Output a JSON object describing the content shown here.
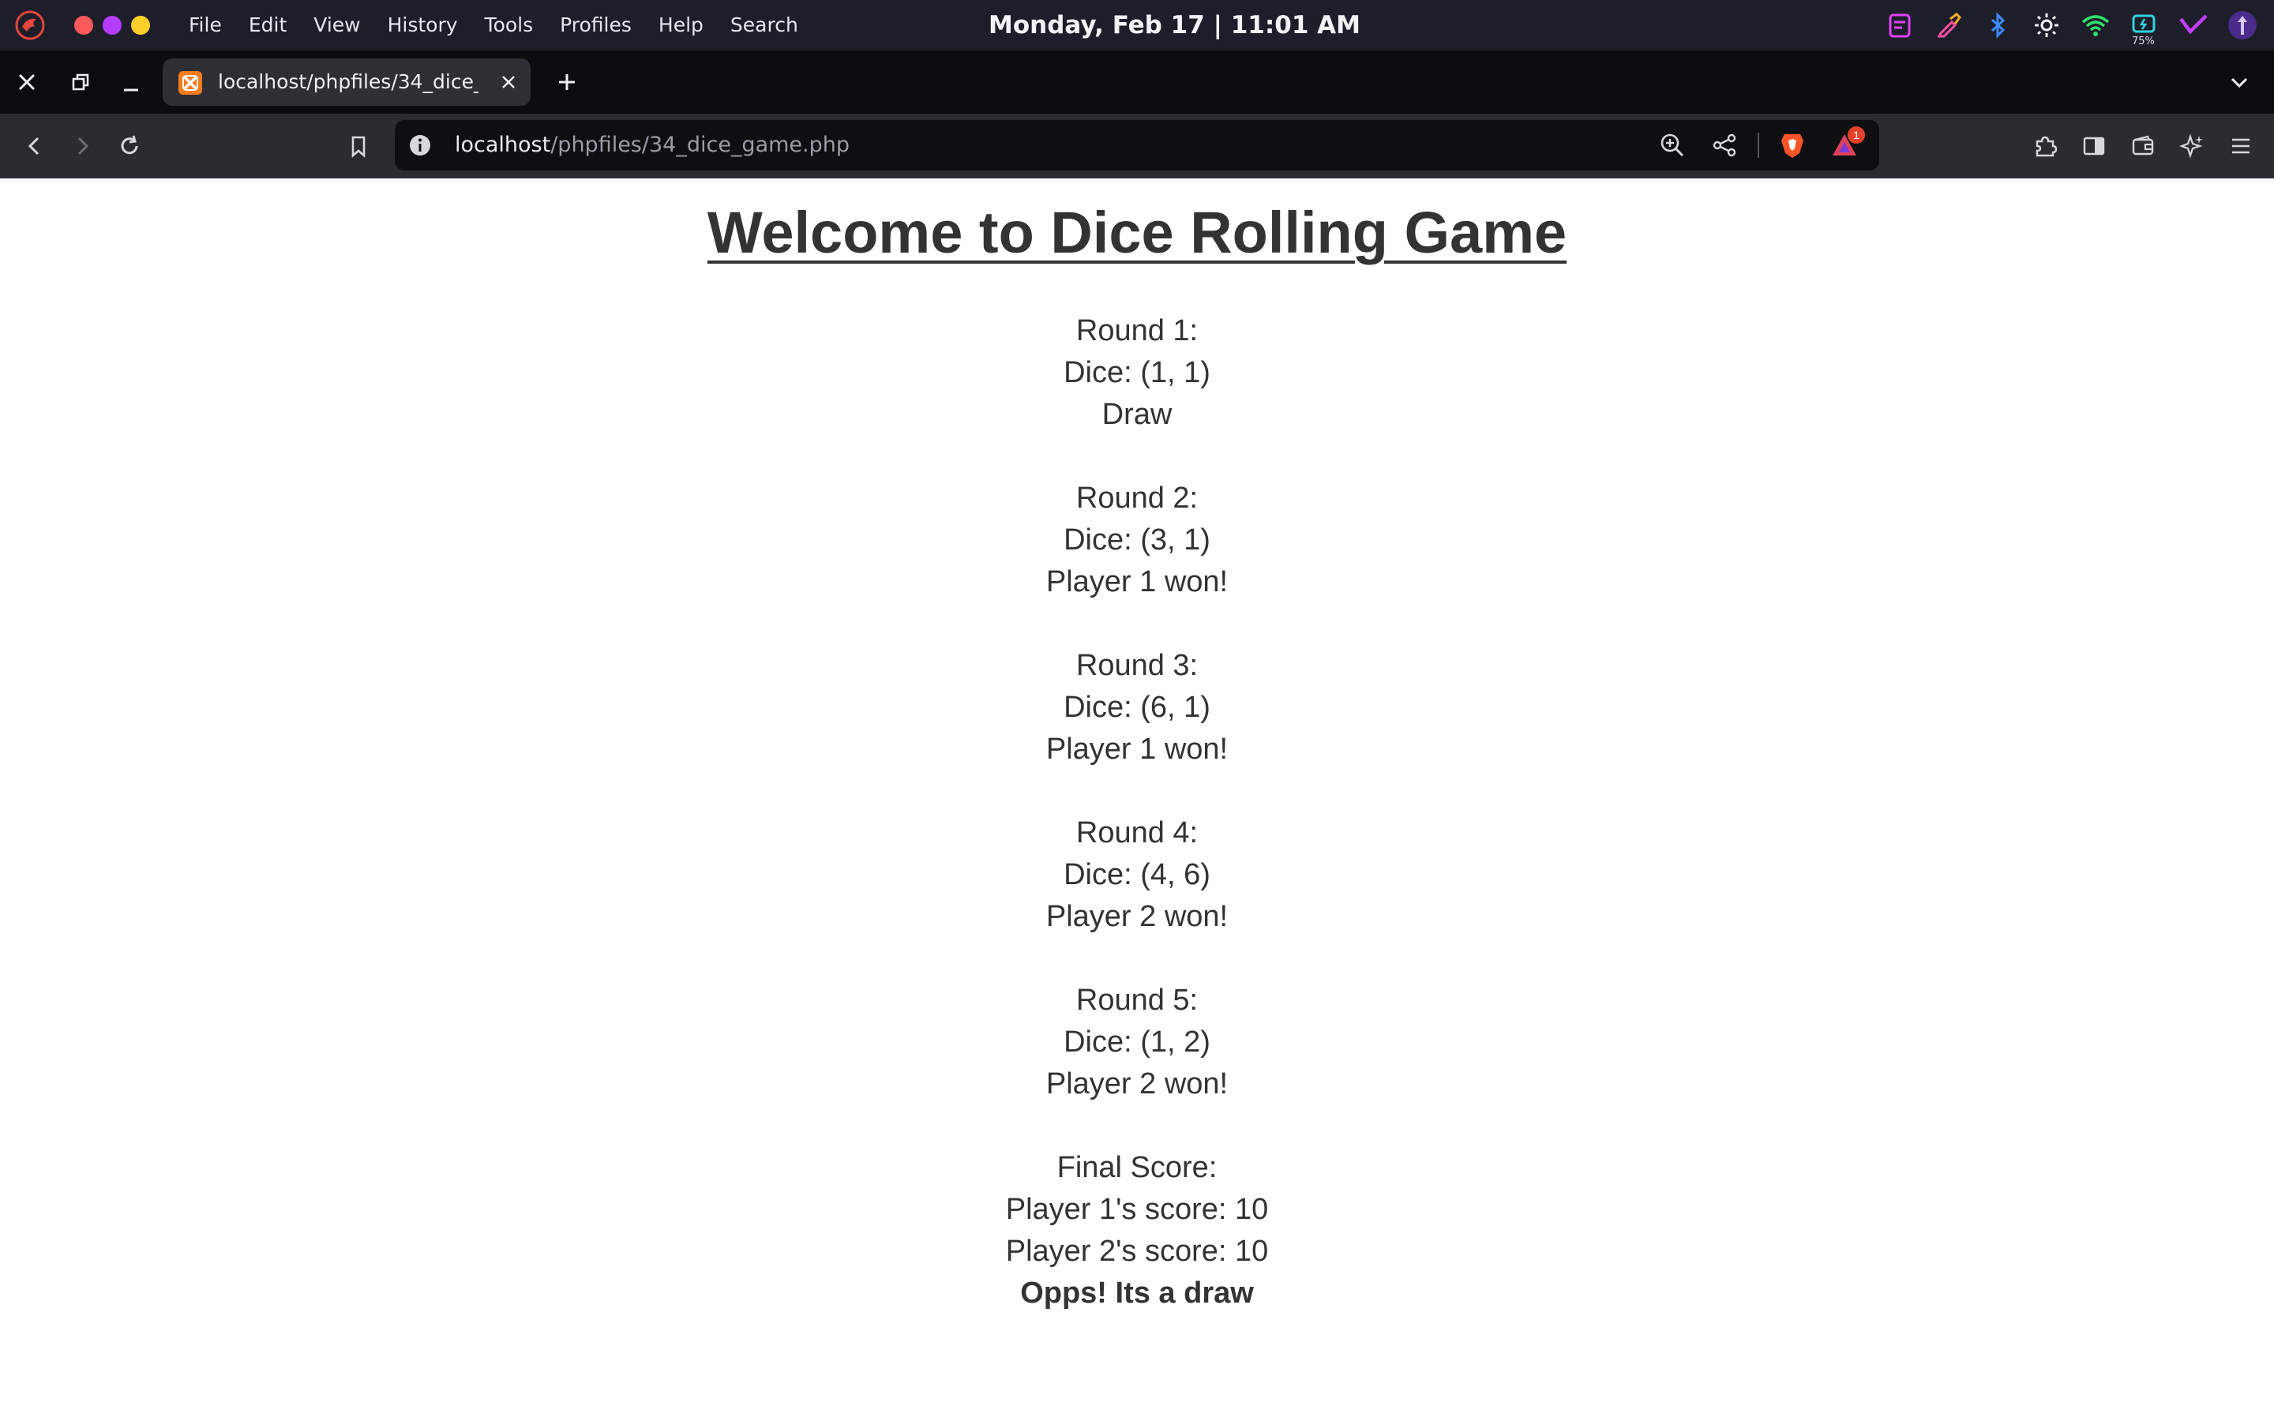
{
  "system": {
    "menus": [
      "File",
      "Edit",
      "View",
      "History",
      "Tools",
      "Profiles",
      "Help",
      "Search"
    ],
    "clock": "Monday, Feb 17 | 11:01 AM",
    "battery_percent": "75%",
    "window_dots": [
      "#ff5a5a",
      "#b63bff",
      "#ffd02a"
    ]
  },
  "browser": {
    "tab_title": "localhost/phpfiles/34_dice_game.php",
    "url_host": "localhost",
    "url_path": "/phpfiles/34_dice_game.php",
    "notification_count": "1"
  },
  "page": {
    "title": "Welcome to Dice Rolling Game",
    "rounds": [
      {
        "label": "Round 1:",
        "dice": "Dice: (1, 1)",
        "result": "Draw"
      },
      {
        "label": "Round 2:",
        "dice": "Dice: (3, 1)",
        "result": "Player 1 won!"
      },
      {
        "label": "Round 3:",
        "dice": "Dice: (6, 1)",
        "result": "Player 1 won!"
      },
      {
        "label": "Round 4:",
        "dice": "Dice: (4, 6)",
        "result": "Player 2 won!"
      },
      {
        "label": "Round 5:",
        "dice": "Dice: (1, 2)",
        "result": "Player 2 won!"
      }
    ],
    "final": {
      "label": "Final Score:",
      "player1": "Player 1's score: 10",
      "player2": "Player 2's score: 10",
      "verdict": "Opps! Its a draw"
    }
  }
}
